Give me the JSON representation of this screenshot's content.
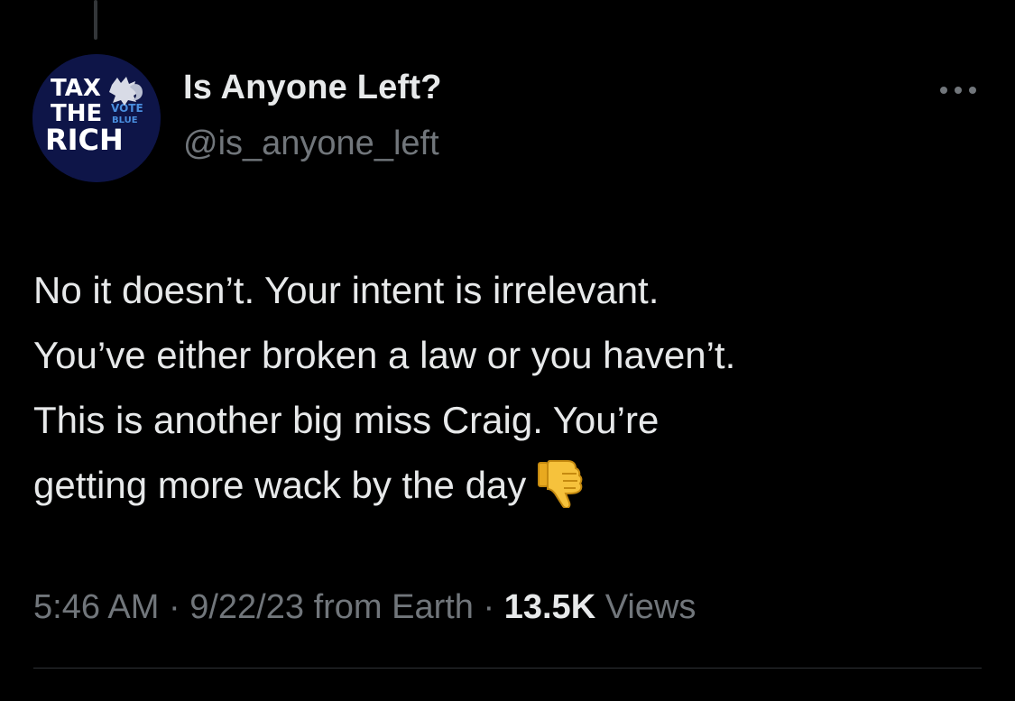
{
  "author": {
    "display_name": "Is Anyone Left?",
    "handle": "@is_anyone_left",
    "avatar": {
      "line1": "TAX",
      "line2": "THE",
      "line3": "RICH",
      "badge_top": "VOTE",
      "badge_bottom": "BLUE",
      "background_color": "#0e1548"
    }
  },
  "tweet": {
    "lines": [
      "No it doesn’t. Your intent is irrelevant.",
      "You’ve either broken a law or you haven’t.",
      "This is another big miss Craig. You’re",
      "getting more wack by the day"
    ],
    "emoji": "thumbs-down-icon"
  },
  "meta": {
    "time": "5:46 AM",
    "sep1": "·",
    "date": "9/22/23",
    "from": "from Earth",
    "sep2": "·",
    "views_count": "13.5K",
    "views_label": "Views"
  },
  "colors": {
    "background": "#000000",
    "primary_text": "#e7e9ea",
    "secondary_text": "#71767b",
    "divider": "#2f3336"
  }
}
